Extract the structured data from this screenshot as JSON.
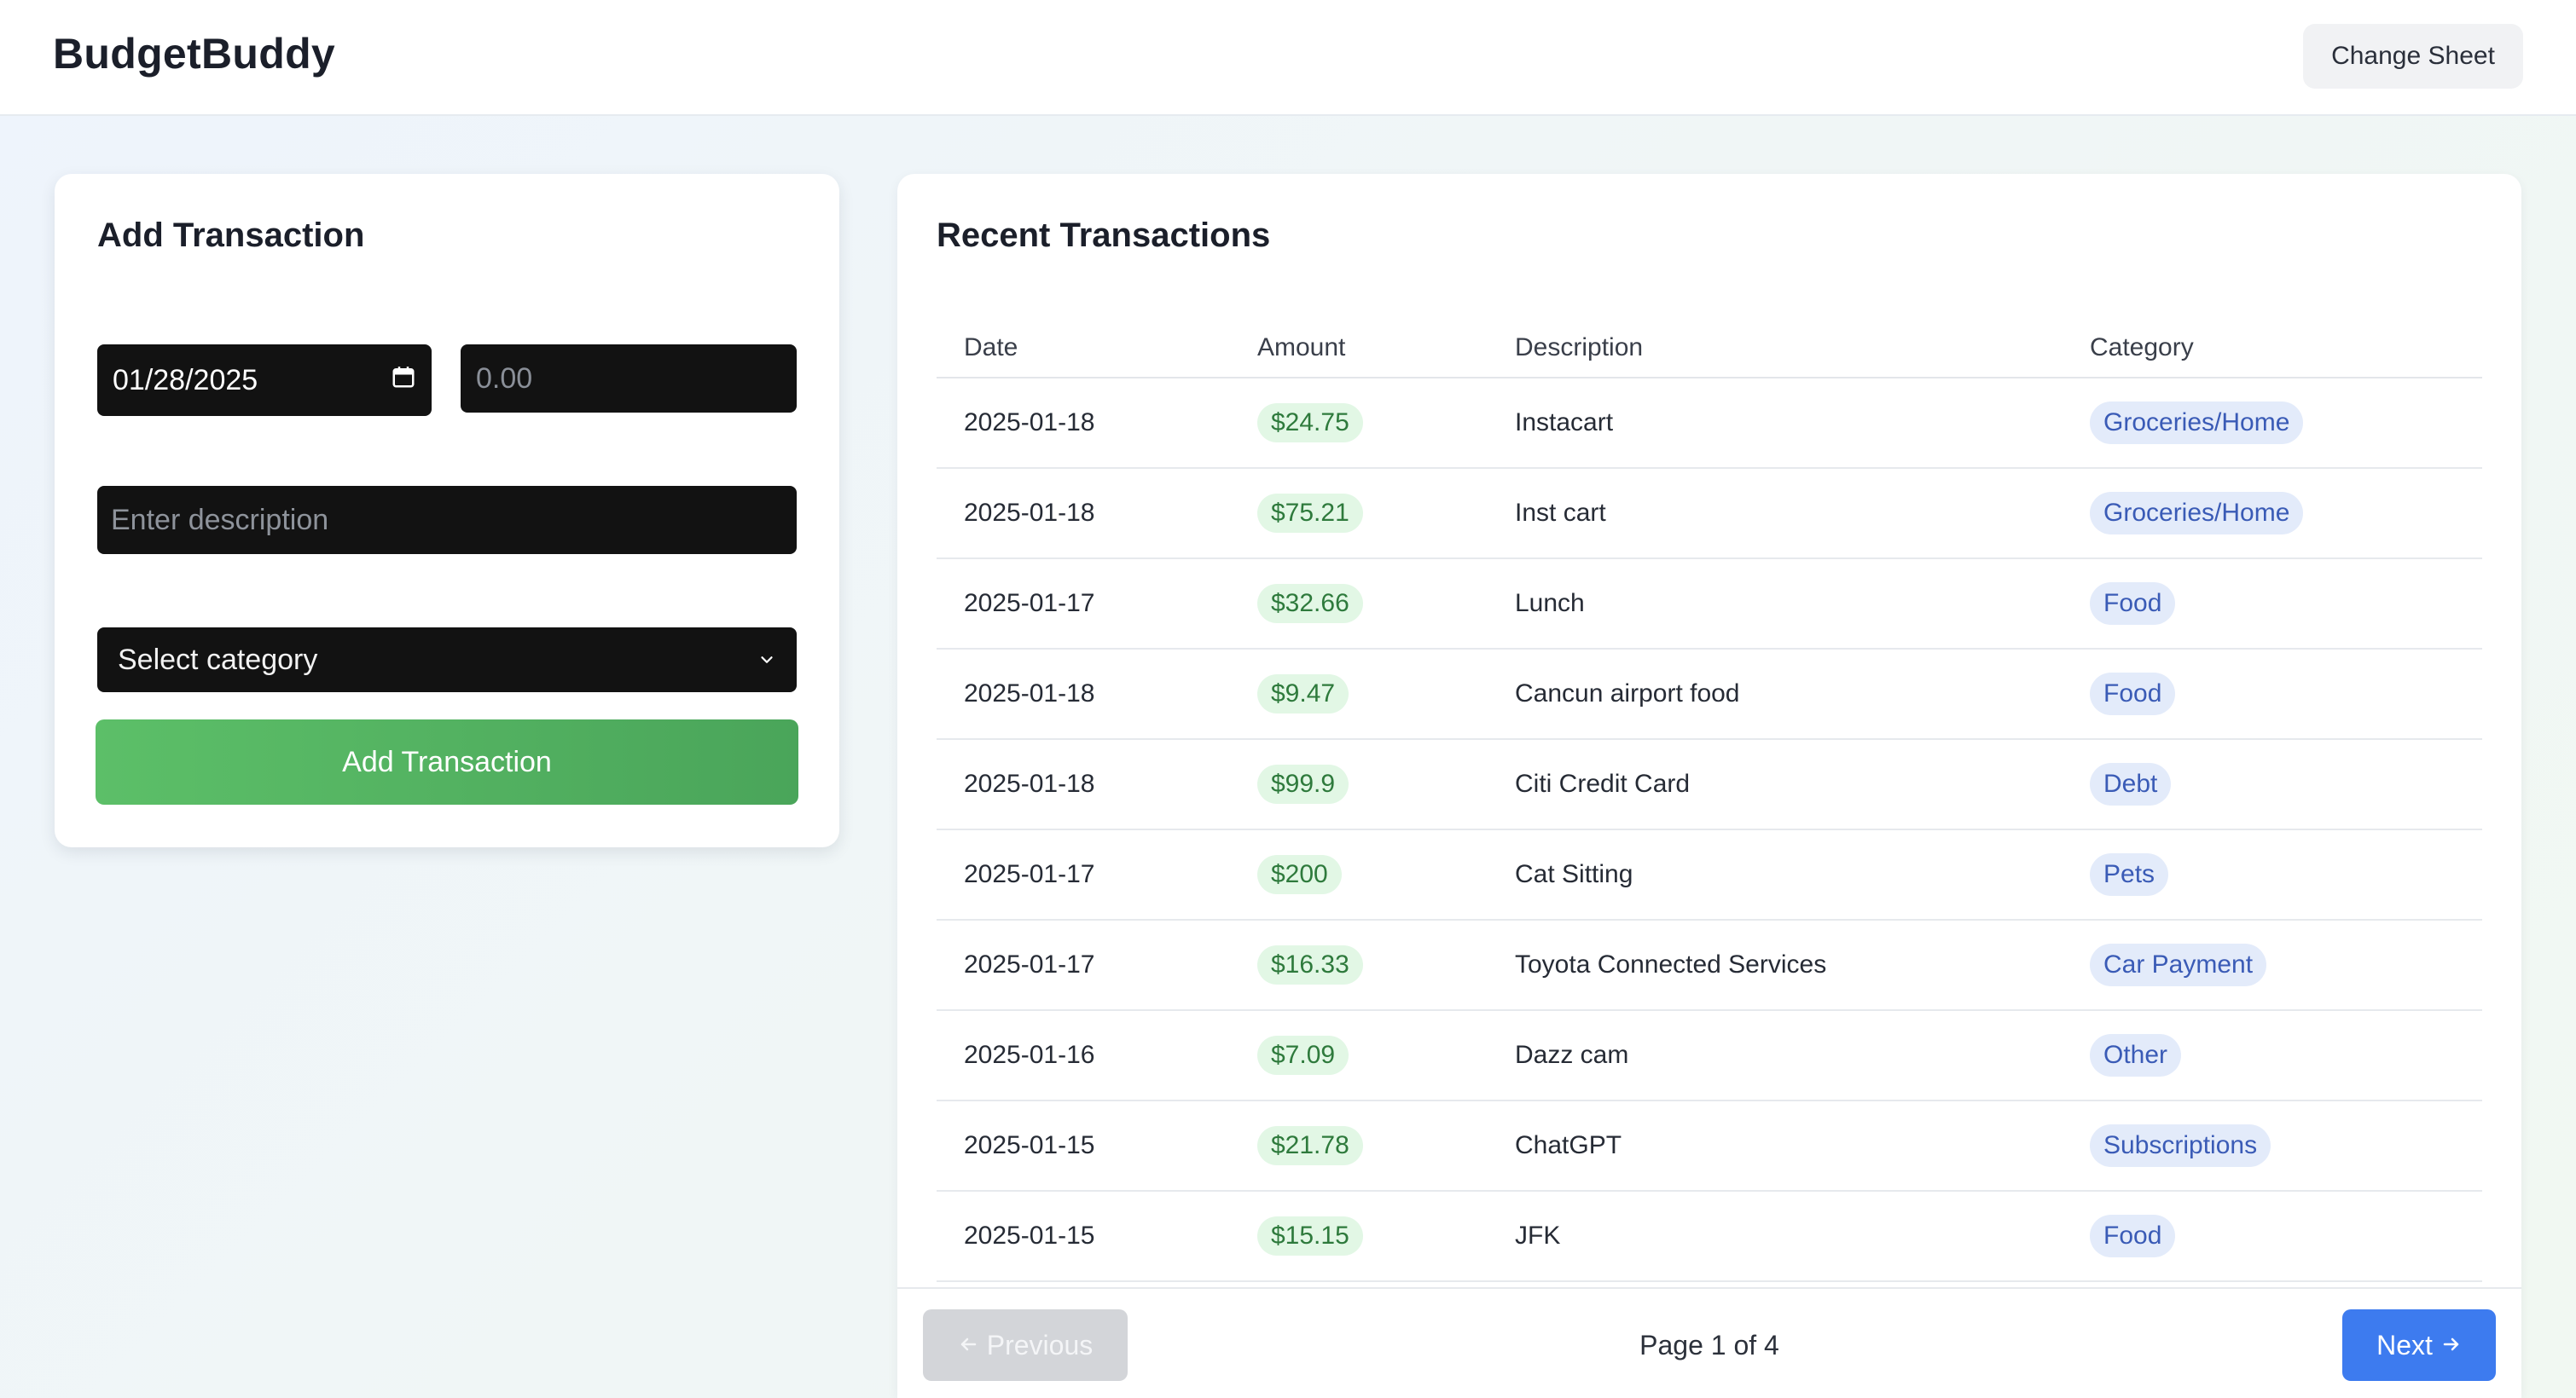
{
  "header": {
    "brand": "BudgetBuddy",
    "change_sheet_label": "Change Sheet"
  },
  "form": {
    "title": "Add Transaction",
    "date_value": "01/28/2025",
    "amount_placeholder": "0.00",
    "description_placeholder": "Enter description",
    "category_selected": "Select category",
    "submit_label": "Add Transaction",
    "submit_color": "#4caf50"
  },
  "transactions": {
    "title": "Recent Transactions",
    "columns": {
      "date": "Date",
      "amount": "Amount",
      "description": "Description",
      "category": "Category"
    },
    "rows": [
      {
        "date": "2025-01-18",
        "amount": "$24.75",
        "description": "Instacart",
        "category": "Groceries/Home"
      },
      {
        "date": "2025-01-18",
        "amount": "$75.21",
        "description": "Inst cart",
        "category": "Groceries/Home"
      },
      {
        "date": "2025-01-17",
        "amount": "$32.66",
        "description": "Lunch",
        "category": "Food"
      },
      {
        "date": "2025-01-18",
        "amount": "$9.47",
        "description": "Cancun airport food",
        "category": "Food"
      },
      {
        "date": "2025-01-18",
        "amount": "$99.9",
        "description": "Citi Credit Card",
        "category": "Debt"
      },
      {
        "date": "2025-01-17",
        "amount": "$200",
        "description": "Cat Sitting",
        "category": "Pets"
      },
      {
        "date": "2025-01-17",
        "amount": "$16.33",
        "description": "Toyota Connected Services",
        "category": "Car Payment"
      },
      {
        "date": "2025-01-16",
        "amount": "$7.09",
        "description": "Dazz cam",
        "category": "Other"
      },
      {
        "date": "2025-01-15",
        "amount": "$21.78",
        "description": "ChatGPT",
        "category": "Subscriptions"
      },
      {
        "date": "2025-01-15",
        "amount": "$15.15",
        "description": "JFK",
        "category": "Food"
      }
    ]
  },
  "pagination": {
    "previous_label": "Previous",
    "page_info": "Page 1 of 4",
    "next_label": "Next",
    "next_color": "#3d7bef"
  },
  "icons": {
    "calendar": "calendar-icon",
    "chevron": "chevron-down-icon",
    "arrow_left": "arrow-left-icon",
    "arrow_right": "arrow-right-icon"
  }
}
